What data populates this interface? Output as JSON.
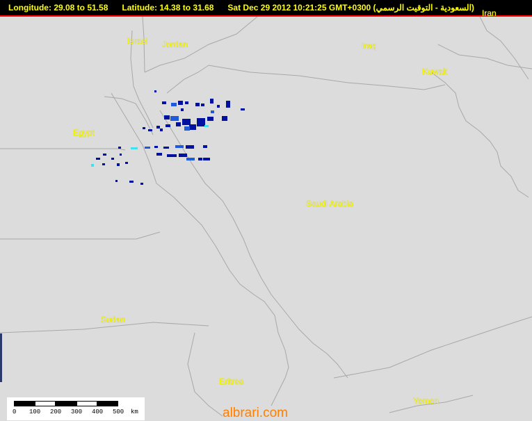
{
  "header": {
    "longitude": "Longitude: 29.08 to 51.58",
    "latitude": "Latitude: 14.38 to 31.68",
    "timestamp": "Sat Dec 29 2012 10:21:25 GMT+0300 (السعودية - التوقيت الرسمي)"
  },
  "labels": {
    "israel": "Israel",
    "jordan": "Jordan",
    "iraq": "Iraq",
    "iran": "Iran",
    "kuwait": "Kuwait",
    "egypt": "Egypt",
    "saudi_arabia": "Saudi Arabia",
    "sudan": "Sudan",
    "eritrea": "Eritrea",
    "yemen": "Yemen"
  },
  "scale": {
    "ticks": [
      "0",
      "100",
      "200",
      "300",
      "400",
      "500",
      "km"
    ]
  },
  "watermark": "albrari.com",
  "colors": {
    "header_bg": "#000000",
    "header_text": "#ffff00",
    "map_bg": "#dcdcdc",
    "border": "#a0a0a0",
    "label": "#ffff00",
    "rain_dark": "#0010a0",
    "rain_mid": "#1e5adc",
    "rain_light": "#40e0f0",
    "watermark": "#ff7f00"
  }
}
